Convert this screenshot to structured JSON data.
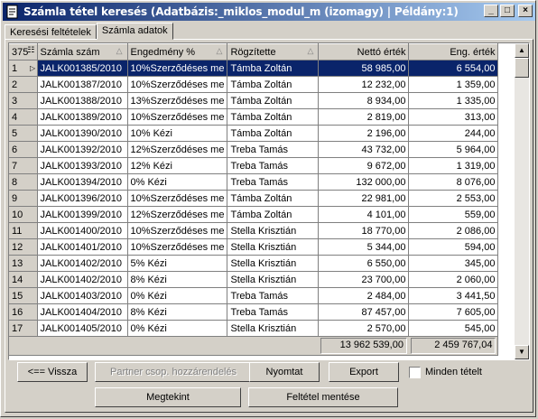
{
  "window": {
    "title": "Számla tétel keresés   (Adatbázis:_miklos_modul_m (izomagy) | Példány:1)",
    "min_label": "_",
    "max_label": "□",
    "close_label": "×"
  },
  "tabs": [
    {
      "label": "Keresési feltételek",
      "active": false
    },
    {
      "label": "Számla adatok",
      "active": true
    }
  ],
  "grid": {
    "row_count_label": "375",
    "columns": [
      "Számla szám",
      "Engedmény %",
      "Rögzítette",
      "Nettó érték",
      "Eng. érték"
    ],
    "rows": [
      {
        "n": "1",
        "szam": "JALK001385/2010",
        "eng": "10%Szerződéses me",
        "rog": "Támba Zoltán",
        "netto": "58 985,00",
        "engert": "6 554,00"
      },
      {
        "n": "2",
        "szam": "JALK001387/2010",
        "eng": "10%Szerződéses me",
        "rog": "Támba Zoltán",
        "netto": "12 232,00",
        "engert": "1 359,00"
      },
      {
        "n": "3",
        "szam": "JALK001388/2010",
        "eng": "13%Szerződéses me",
        "rog": "Támba Zoltán",
        "netto": "8 934,00",
        "engert": "1 335,00"
      },
      {
        "n": "4",
        "szam": "JALK001389/2010",
        "eng": "10%Szerződéses me",
        "rog": "Támba Zoltán",
        "netto": "2 819,00",
        "engert": "313,00"
      },
      {
        "n": "5",
        "szam": "JALK001390/2010",
        "eng": "10% Kézi",
        "rog": "Támba Zoltán",
        "netto": "2 196,00",
        "engert": "244,00"
      },
      {
        "n": "6",
        "szam": "JALK001392/2010",
        "eng": "12%Szerződéses me",
        "rog": "Treba Tamás",
        "netto": "43 732,00",
        "engert": "5 964,00"
      },
      {
        "n": "7",
        "szam": "JALK001393/2010",
        "eng": "12% Kézi",
        "rog": "Treba Tamás",
        "netto": "9 672,00",
        "engert": "1 319,00"
      },
      {
        "n": "8",
        "szam": "JALK001394/2010",
        "eng": "0% Kézi",
        "rog": "Treba Tamás",
        "netto": "132 000,00",
        "engert": "8 076,00"
      },
      {
        "n": "9",
        "szam": "JALK001396/2010",
        "eng": "10%Szerződéses me",
        "rog": "Támba Zoltán",
        "netto": "22 981,00",
        "engert": "2 553,00"
      },
      {
        "n": "10",
        "szam": "JALK001399/2010",
        "eng": "12%Szerződéses me",
        "rog": "Támba Zoltán",
        "netto": "4 101,00",
        "engert": "559,00"
      },
      {
        "n": "11",
        "szam": "JALK001400/2010",
        "eng": "10%Szerződéses me",
        "rog": "Stella Krisztián",
        "netto": "18 770,00",
        "engert": "2 086,00"
      },
      {
        "n": "12",
        "szam": "JALK001401/2010",
        "eng": "10%Szerződéses me",
        "rog": "Stella Krisztián",
        "netto": "5 344,00",
        "engert": "594,00"
      },
      {
        "n": "13",
        "szam": "JALK001402/2010",
        "eng": "5% Kézi",
        "rog": "Stella Krisztián",
        "netto": "6 550,00",
        "engert": "345,00"
      },
      {
        "n": "14",
        "szam": "JALK001402/2010",
        "eng": "8% Kézi",
        "rog": "Stella Krisztián",
        "netto": "23 700,00",
        "engert": "2 060,00"
      },
      {
        "n": "15",
        "szam": "JALK001403/2010",
        "eng": "0% Kézi",
        "rog": "Treba Tamás",
        "netto": "2 484,00",
        "engert": "3 441,50"
      },
      {
        "n": "16",
        "szam": "JALK001404/2010",
        "eng": "8% Kézi",
        "rog": "Treba Tamás",
        "netto": "87 457,00",
        "engert": "7 605,00"
      },
      {
        "n": "17",
        "szam": "JALK001405/2010",
        "eng": "0% Kézi",
        "rog": "Stella Krisztián",
        "netto": "2 570,00",
        "engert": "545,00"
      }
    ],
    "sum_netto": "13 962 539,00",
    "sum_eng": "2 459 767,04"
  },
  "buttons": {
    "back": "<== Vissza",
    "partner": "Partner csop. hozzárendelés",
    "print": "Nyomtat",
    "export": "Export",
    "all_items": "Minden tételt",
    "view": "Megtekint",
    "save_filter": "Feltétel mentése"
  }
}
